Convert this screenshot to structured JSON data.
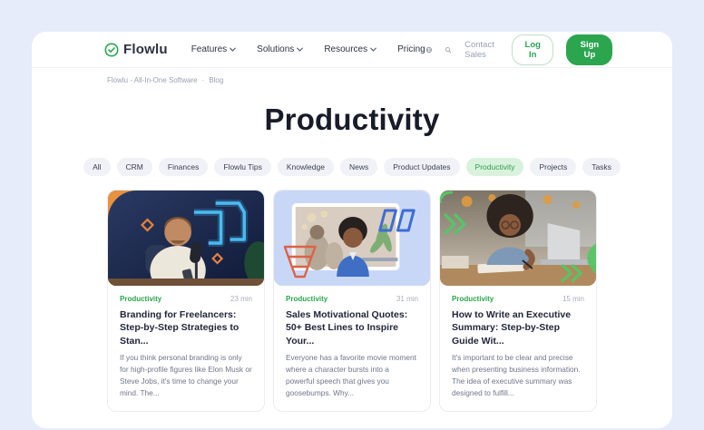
{
  "header": {
    "logo": "Flowlu",
    "nav": [
      "Features",
      "Solutions",
      "Resources",
      "Pricing"
    ],
    "contact_sales": "Contact Sales",
    "log_in": "Log In",
    "sign_up": "Sign Up"
  },
  "breadcrumb": {
    "root": "Flowlu - All-In-One Software",
    "separator": "·",
    "current": "Blog"
  },
  "page_title": "Productivity",
  "filters": {
    "items": [
      "All",
      "CRM",
      "Finances",
      "Flowlu Tips",
      "Knowledge",
      "News",
      "Product Updates",
      "Productivity",
      "Projects",
      "Tasks"
    ],
    "active": "Productivity"
  },
  "articles": [
    {
      "category": "Productivity",
      "read_time": "23 min",
      "title": "Branding for Freelancers: Step-by-Step Strategies to Stan...",
      "excerpt": "If you think personal branding is only for high-profile figures like Elon Musk or Steve Jobs, it's time to change your mind. The..."
    },
    {
      "category": "Productivity",
      "read_time": "31 min",
      "title": "Sales Motivational Quotes: 50+ Best Lines to Inspire Your...",
      "excerpt": "Everyone has a favorite movie moment where a character bursts into a powerful speech that gives you goosebumps. Why..."
    },
    {
      "category": "Productivity",
      "read_time": "15 min",
      "title": "How to Write an Executive Summary: Step-by-Step Guide Wit...",
      "excerpt": "It's important to be clear and precise when presenting business information. The idea of executive summary was designed to fulfill..."
    }
  ],
  "icons": {
    "logo": "check-shield",
    "globe": "globe",
    "search": "magnifier",
    "nav_chevron": "chevron-down"
  },
  "colors": {
    "brand_green": "#2ca54f",
    "active_pill_bg": "#d9f2dd",
    "active_pill_text": "#2f9e4e",
    "page_bg": "#e7ecfa"
  }
}
